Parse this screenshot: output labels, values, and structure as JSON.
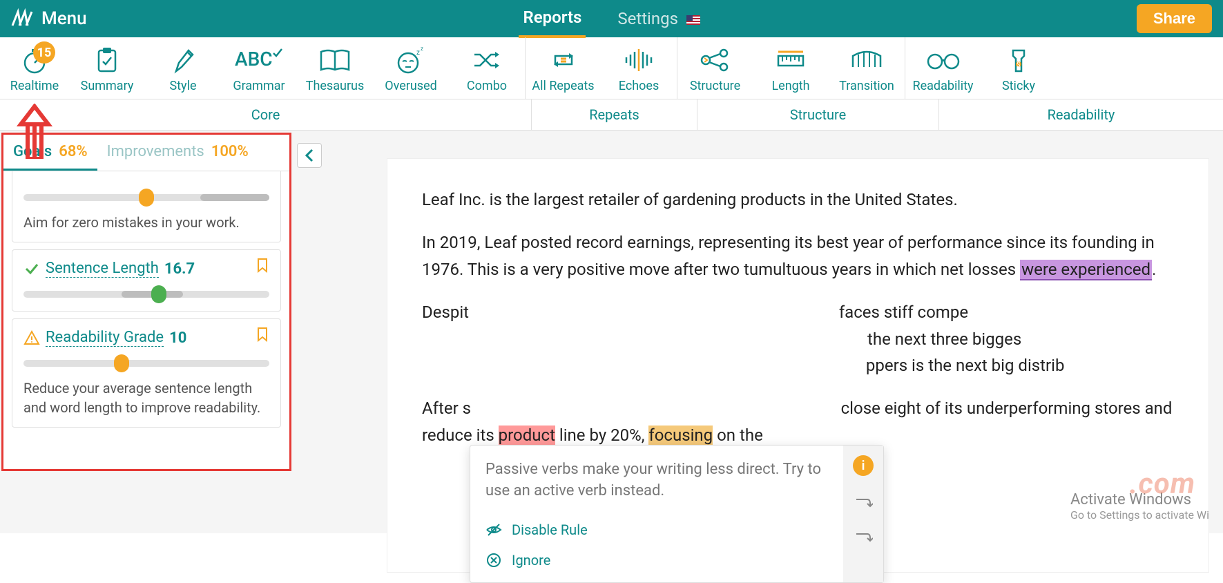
{
  "topbar": {
    "menu": "Menu",
    "tabs": {
      "reports": "Reports",
      "settings": "Settings"
    },
    "share": "Share"
  },
  "toolbar": {
    "items": [
      {
        "label": "Realtime",
        "badge": "15"
      },
      {
        "label": "Summary"
      },
      {
        "label": "Style"
      },
      {
        "label": "Grammar"
      },
      {
        "label": "Thesaurus"
      },
      {
        "label": "Overused"
      },
      {
        "label": "Combo"
      },
      {
        "label": "All Repeats"
      },
      {
        "label": "Echoes"
      },
      {
        "label": "Structure"
      },
      {
        "label": "Length"
      },
      {
        "label": "Transition"
      },
      {
        "label": "Readability"
      },
      {
        "label": "Sticky"
      }
    ],
    "groups": {
      "core": "Core",
      "repeats": "Repeats",
      "structure": "Structure",
      "readability": "Readability"
    }
  },
  "sidebar": {
    "tabs": {
      "goals": {
        "name": "Goals",
        "pct": "68%"
      },
      "improvements": {
        "name": "Improvements",
        "pct": "100%"
      }
    },
    "card0_tip": "Aim for zero mistakes in your work.",
    "card1": {
      "name": "Sentence Length",
      "value": "16.7"
    },
    "card2": {
      "name": "Readability Grade",
      "value": "10",
      "tip": "Reduce your average sentence length and word length to improve readability."
    }
  },
  "document": {
    "p1": "Leaf Inc. is the largest retailer of gardening products in the United States.",
    "p2_a": "In 2019, Leaf posted record earnings, representing its best year of performance since its founding in 1976. This is a very positive move after two tumultuous years in which net losses ",
    "p2_hl": "were experienced",
    "p2_b": ".",
    "p3_a": "Despit",
    "p3_b": "faces stiff compe",
    "p3_c": "the next three bigges",
    "p3_d": "ppers is the next big distrib",
    "p4_a": "After s",
    "p4_b": "close eight of its underperforming stores and reduce its ",
    "p4_hl1": "product",
    "p4_c": " line by 20%, ",
    "p4_hl2": "focusing",
    "p4_d": " on the"
  },
  "tooltip": {
    "msg": "Passive verbs make your writing less direct. Try to use an active verb instead.",
    "disable": "Disable Rule",
    "ignore": "Ignore"
  },
  "watermark": {
    "win_title": "Activate Windows",
    "win_sub": "Go to Settings to activate Wi",
    "site": ".com"
  }
}
